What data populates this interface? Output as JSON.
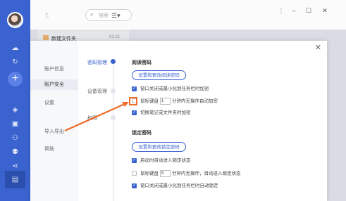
{
  "search": {
    "placeholder": "搜索"
  },
  "file_list": {
    "items": [
      {
        "name": "新建文件夹",
        "date": "03-21"
      }
    ]
  },
  "dialog": {
    "nav": [
      {
        "label": "账户信息"
      },
      {
        "label": "账户安全"
      },
      {
        "label": "设置"
      },
      {
        "label": "导入导出"
      },
      {
        "label": "帮助"
      }
    ],
    "sections": [
      {
        "label": "密码管理"
      },
      {
        "label": "设备管理"
      },
      {
        "label": "权限"
      }
    ],
    "read_pwd": {
      "title": "阅读密码",
      "button": "设置和更改阅读密码",
      "opt1": "窗口关闭或最小化到任务栏时加密",
      "opt2_pre": "鼠标键盘",
      "opt2_val": "1",
      "opt2_post": "分钟内无操作自动加密",
      "opt3": "切换笔记或文件夹时加密"
    },
    "lock_pwd": {
      "title": "锁定密码",
      "button": "设置和更改锁定密码",
      "opt1": "启动时自动进入锁定状态",
      "opt2_pre": "鼠标键盘",
      "opt2_val": "5",
      "opt2_post": "分钟内无操作，自动进入锁定状态",
      "opt3": "窗口关闭或最小化到任务栏时自动锁定"
    }
  },
  "colors": {
    "accent": "#3a63cf",
    "annotation": "#ee6b2a"
  }
}
